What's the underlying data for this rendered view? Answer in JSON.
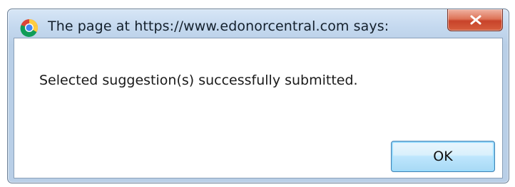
{
  "dialog": {
    "title": "The page at https://www.edonorcentral.com says:",
    "title_icon": "chrome-icon",
    "close_icon": "close-icon",
    "message": "Selected suggestion(s) successfully submitted.",
    "ok_label": "OK"
  },
  "colors": {
    "titlebar": "#c5d9ef",
    "close_button": "#c8432a",
    "ok_border": "#3c7fb1"
  }
}
